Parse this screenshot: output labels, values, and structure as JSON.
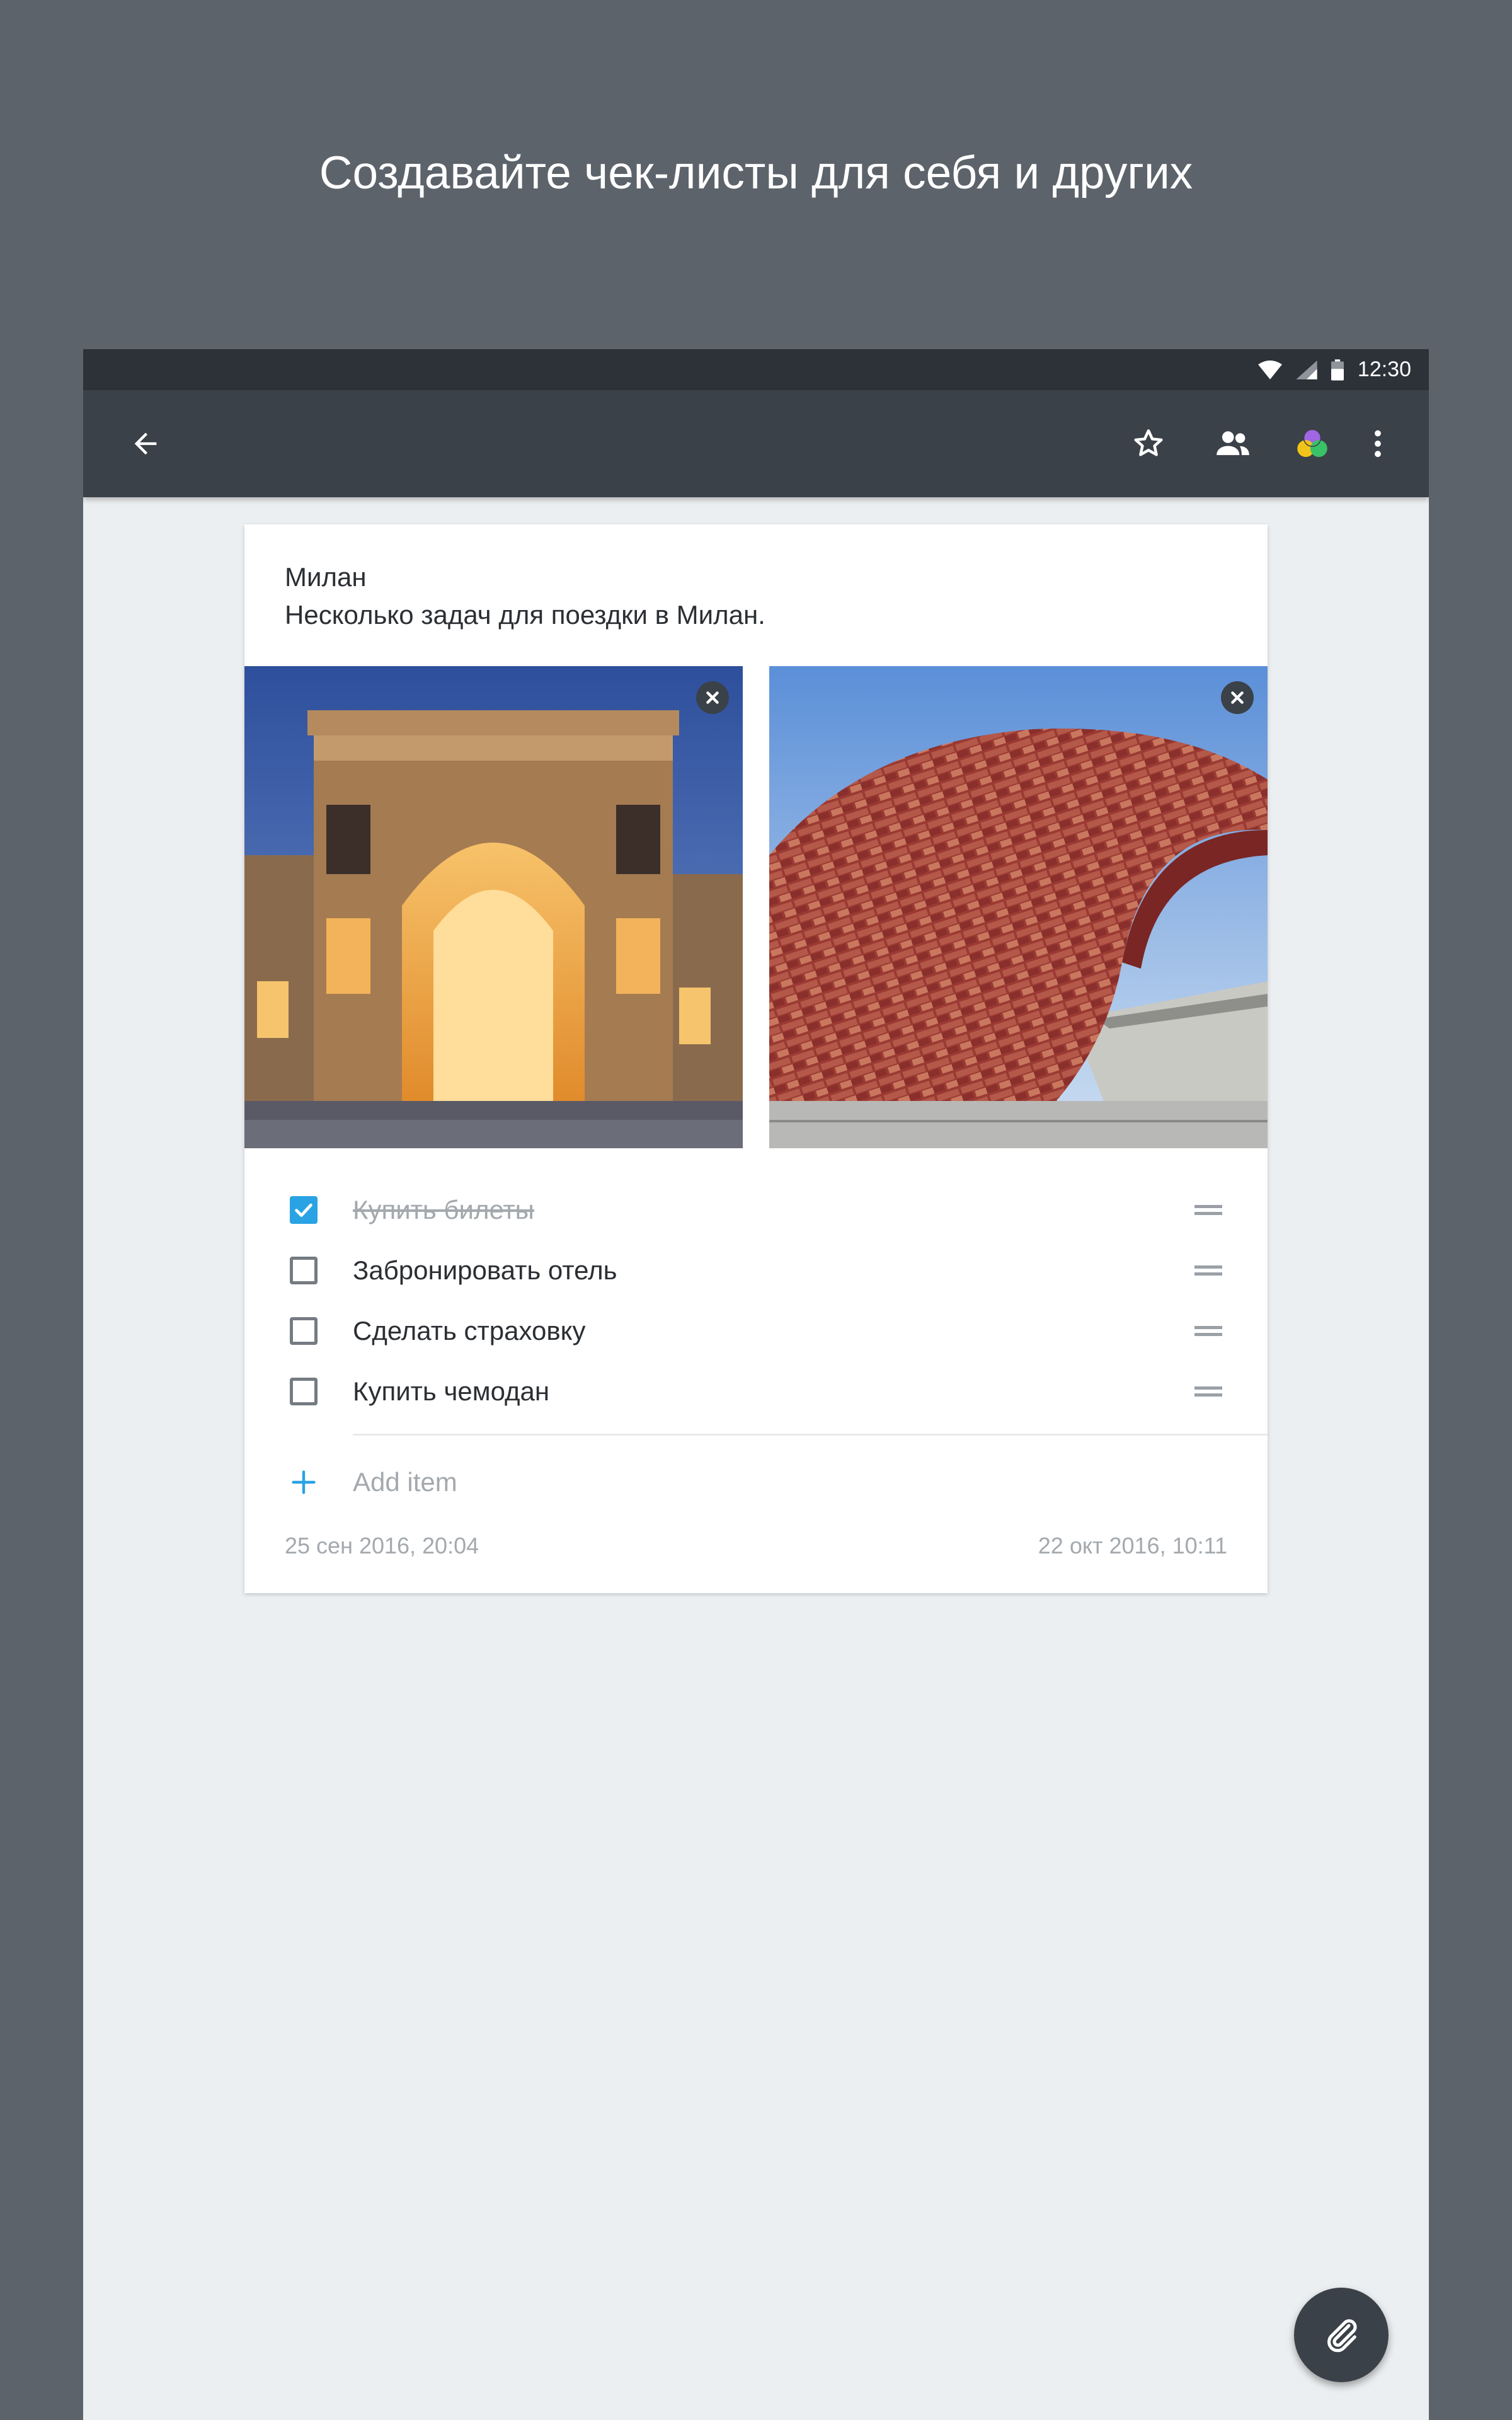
{
  "headline": "Создавайте чек-листы для себя и других",
  "status_bar": {
    "time": "12:30",
    "icons": [
      "wifi-icon",
      "signal-icon",
      "battery-icon"
    ]
  },
  "app_bar": {
    "icons": [
      "back-arrow-icon",
      "star-icon",
      "people-icon",
      "color-icon",
      "more-vert-icon"
    ]
  },
  "note": {
    "title": "Милан",
    "description": "Несколько задач для поездки в Милан.",
    "images": [
      {
        "subject": "Galleria Vittorio Emanuele II at dusk"
      },
      {
        "subject": "Red tiled pavilion with staircase"
      }
    ],
    "items": [
      {
        "text": "Купить билеты",
        "checked": true
      },
      {
        "text": "Забронировать отель",
        "checked": false
      },
      {
        "text": "Сделать страховку",
        "checked": false
      },
      {
        "text": "Купить чемодан",
        "checked": false
      }
    ],
    "add_item_label": "Add item",
    "created": "25 сен 2016, 20:04",
    "modified": "22 окт 2016, 10:11"
  },
  "colors": {
    "accent": "#29a3e3",
    "app_bar": "#3b4148",
    "background": "#5c636b"
  },
  "fab": {
    "icon": "paperclip-icon"
  }
}
